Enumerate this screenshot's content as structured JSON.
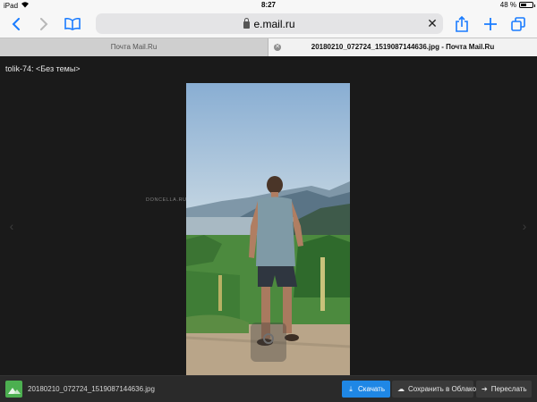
{
  "status_bar": {
    "device": "iPad",
    "time": "8:27",
    "battery_text": "48 %",
    "battery_level": 0.48
  },
  "toolbar": {
    "url": "e.mail.ru",
    "load_progress": 0.4,
    "accent_color": "#1a7cff"
  },
  "tabs": [
    {
      "label": "Почта Mail.Ru"
    },
    {
      "label": "20180210_072724_1519087144636.jpg - Почта Mail.Ru"
    }
  ],
  "viewer": {
    "sender": "tolik-74: <Без темы>",
    "watermark": "DONCELLA.RU",
    "prev_icon": "chevron-left-icon",
    "next_icon": "chevron-right-icon"
  },
  "bottom_bar": {
    "filename": "20180210_072724_1519087144636.jpg",
    "download_label": "Скачать",
    "save_cloud_label": "Сохранить в Облако",
    "forward_label": "Переслать",
    "download_color": "#1f87e5"
  }
}
